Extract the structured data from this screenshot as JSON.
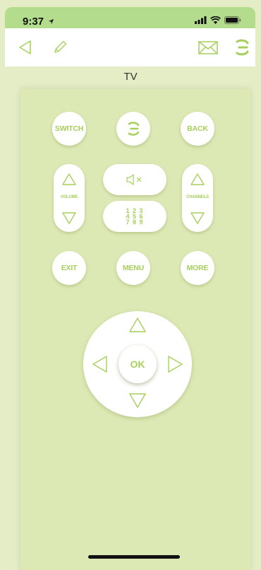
{
  "status_bar": {
    "time": "9:37"
  },
  "device": {
    "title": "TV"
  },
  "remote": {
    "switch_label": "SWITCH",
    "back_label": "BACK",
    "volume_label": "VOLUME",
    "channels_label": "CHANNELS",
    "digits": [
      "1 2 3",
      "4 5 6",
      "7 8 9"
    ],
    "exit_label": "EXIT",
    "menu_label": "MENU",
    "more_label": "MORE",
    "ok_label": "OK"
  },
  "colors": {
    "accent": "#a6d05b",
    "background": "#e5edc6",
    "panel": "#dde9b5",
    "status_bar": "#b3dd8c"
  },
  "icons": [
    "back-arrow-icon",
    "edit-pencil-icon",
    "mail-icon",
    "brand-logo-icon",
    "mute-icon",
    "up-arrow-icon",
    "down-arrow-icon",
    "left-arrow-icon",
    "right-arrow-icon"
  ]
}
